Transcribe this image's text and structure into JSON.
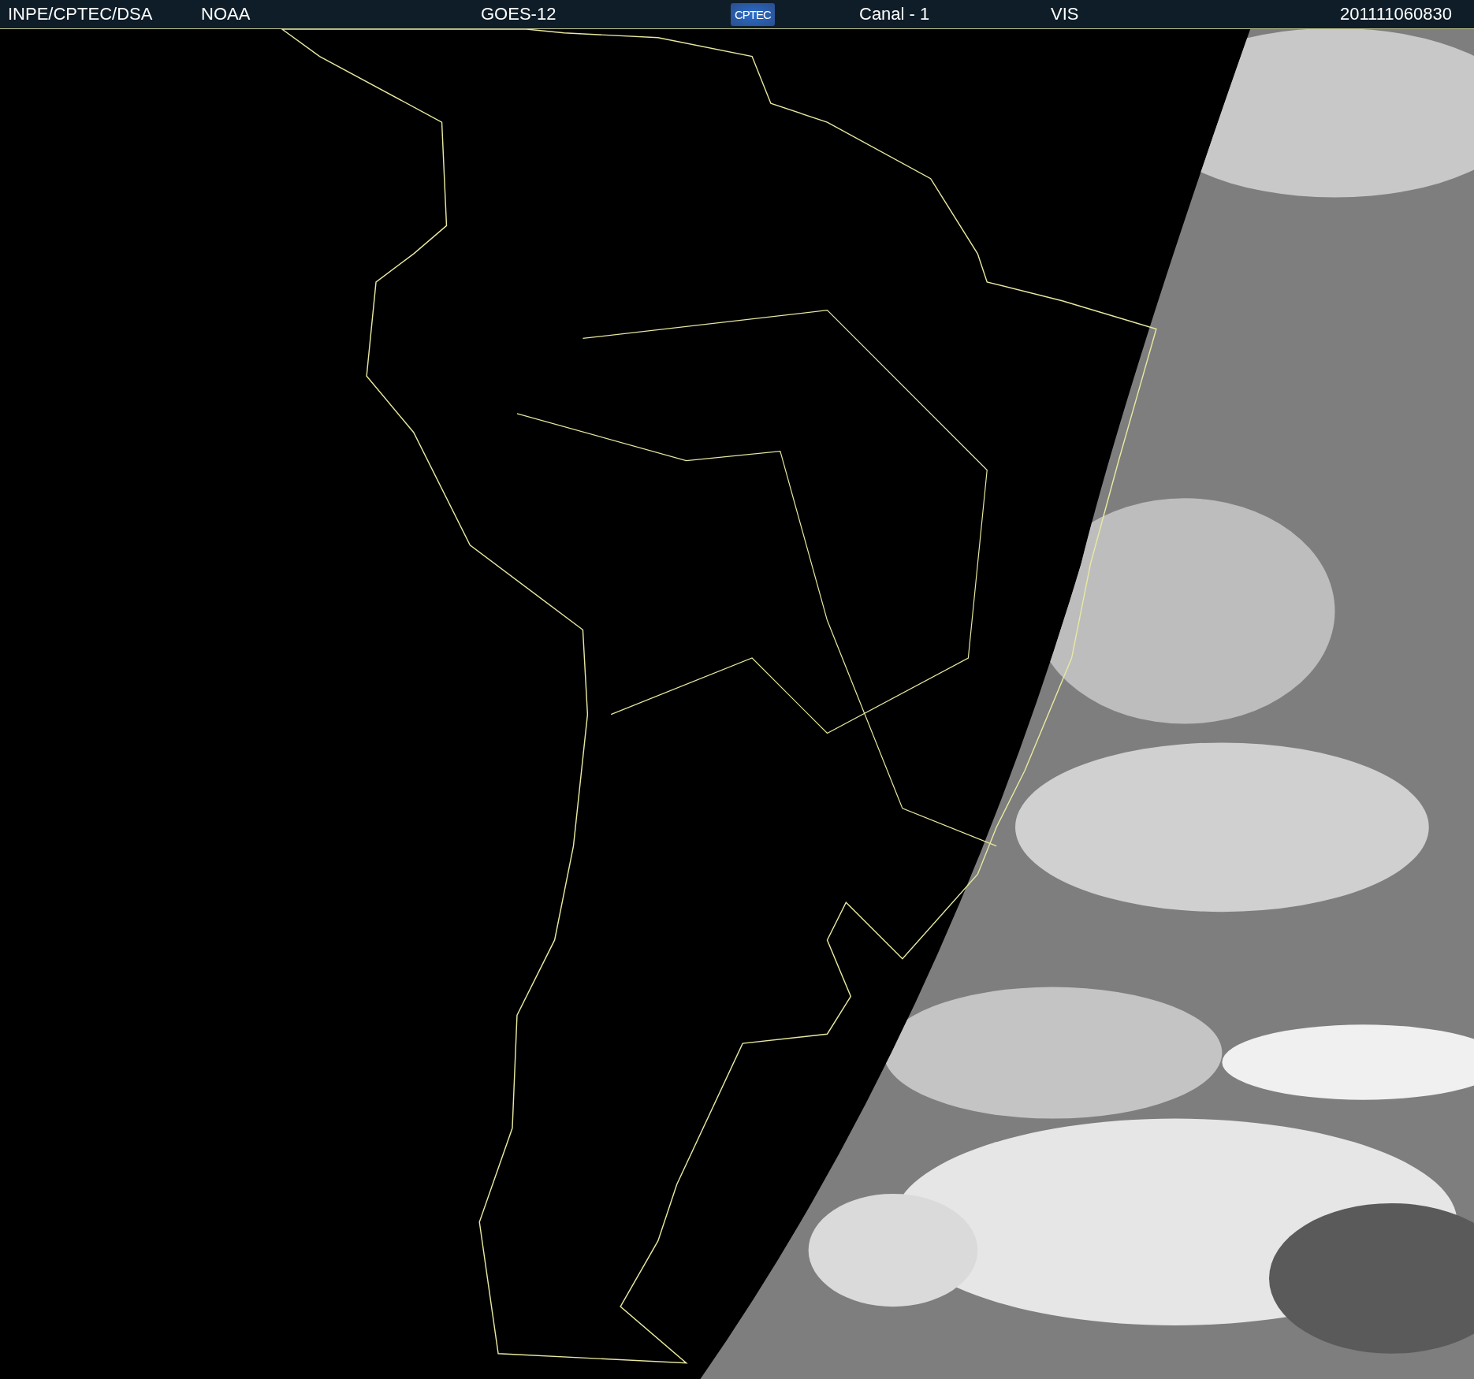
{
  "header": {
    "items": [
      {
        "kind": "text",
        "text": "INPE/CPTEC/DSA"
      },
      {
        "kind": "text",
        "text": "NOAA"
      },
      {
        "kind": "text",
        "text": "GOES-12"
      },
      {
        "kind": "logo",
        "text": "CPTEC"
      },
      {
        "kind": "text",
        "text": "Canal - 1"
      },
      {
        "kind": "text",
        "text": "VIS"
      },
      {
        "kind": "text",
        "text": "201111060830"
      }
    ]
  }
}
